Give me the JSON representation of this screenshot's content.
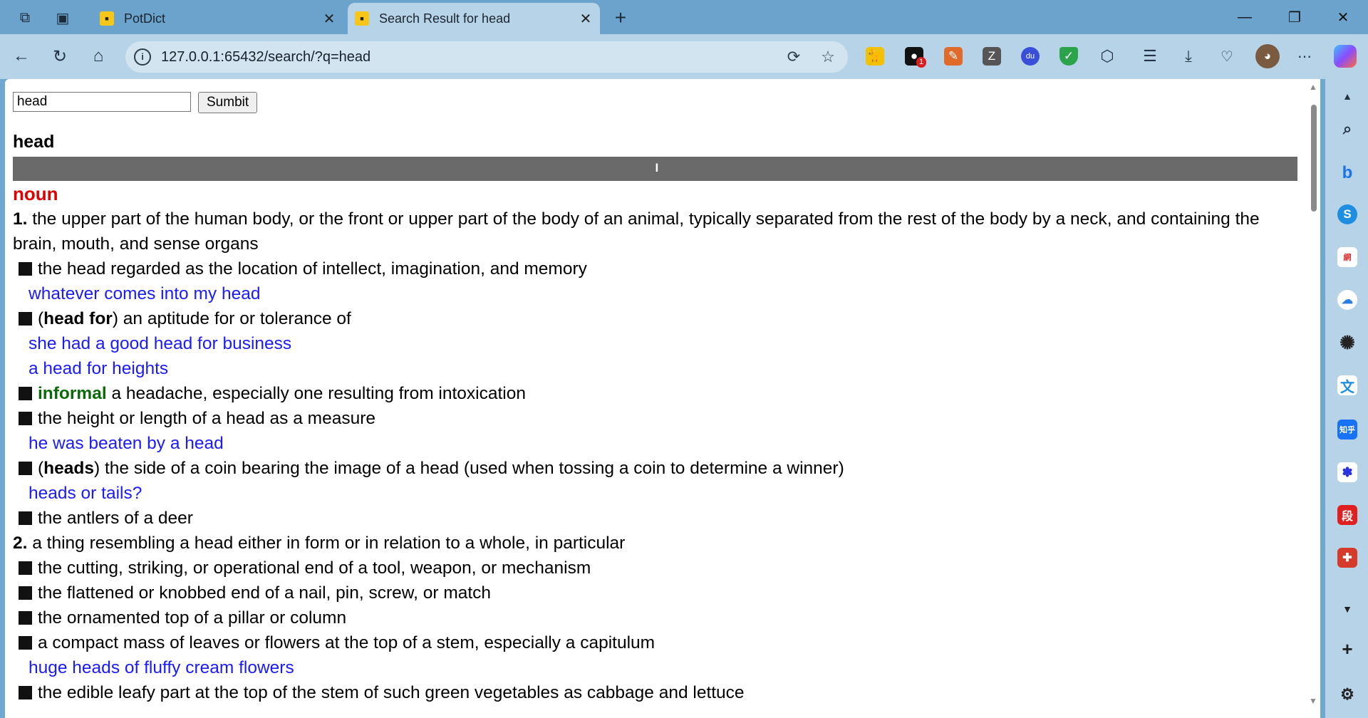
{
  "browser": {
    "tabs": [
      {
        "title": "PotDict",
        "favicon_text": "PotDict"
      },
      {
        "title": "Search Result for head",
        "favicon_text": "PotDict"
      }
    ],
    "url": "127.0.0.1:65432/search/?q=head",
    "extension_badge": "1"
  },
  "search": {
    "value": "head",
    "button_label": "Sumbit"
  },
  "entry": {
    "headword": "head",
    "phonetic": "I",
    "pos": "noun",
    "def1_num": "1.",
    "def1_text": "the upper part of the human body, or the front or upper part of the body of an animal, typically separated from the rest of the body by a neck, and containing the brain, mouth, and sense organs",
    "s1": "the head regarded as the location of intellect, imagination, and memory",
    "s1_ex1": "whatever comes into my head",
    "s2_open": "(",
    "s2_bold": "head for",
    "s2_rest": ") an aptitude for or tolerance of",
    "s2_ex1": "she had a good head for business",
    "s2_ex2": "a head for heights",
    "s3_label": "informal",
    "s3_text": " a headache, especially one resulting from intoxication",
    "s4": "the height or length of a head as a measure",
    "s4_ex1": "he was beaten by a head",
    "s5_open": "(",
    "s5_bold": "heads",
    "s5_rest": ") the side of a coin bearing the image of a head (used when tossing a coin to determine a winner)",
    "s5_ex1": "heads or tails?",
    "s6": "the antlers of a deer",
    "def2_num": "2.",
    "def2_text": "a thing resembling a head either in form or in relation to a whole, in particular",
    "s7": "the cutting, striking, or operational end of a tool, weapon, or mechanism",
    "s8": "the flattened or knobbed end of a nail, pin, screw, or match",
    "s9": "the ornamented top of a pillar or column",
    "s10": "a compact mass of leaves or flowers at the top of a stem, especially a capitulum",
    "s10_ex1": "huge heads of fluffy cream flowers",
    "s11": "the edible leafy part at the top of the stem of such green vegetables as cabbage and lettuce"
  },
  "sidebar_icons": {
    "duan_label": "段",
    "zhihu_label": "知乎"
  }
}
